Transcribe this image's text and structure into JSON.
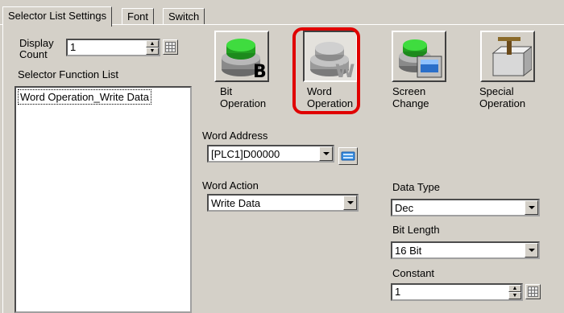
{
  "tabs": [
    {
      "label": "Selector List Settings",
      "active": true
    },
    {
      "label": "Font",
      "active": false
    },
    {
      "label": "Switch",
      "active": false
    }
  ],
  "left": {
    "display_count_label_1": "Display",
    "display_count_label_2": "Count",
    "display_count_value": "1",
    "function_list_label": "Selector Function List",
    "function_list_items": [
      "Word Operation_Write Data"
    ]
  },
  "function_buttons": [
    {
      "line1": "Bit",
      "line2": "Operation",
      "selected": false,
      "icon": "bit-switch-icon"
    },
    {
      "line1": "Word",
      "line2": "Operation",
      "selected": true,
      "icon": "word-switch-icon"
    },
    {
      "line1": "Screen",
      "line2": "Change",
      "selected": false,
      "icon": "screen-change-icon"
    },
    {
      "line1": "Special",
      "line2": "Operation",
      "selected": false,
      "icon": "special-operation-icon"
    }
  ],
  "word_address": {
    "label": "Word Address",
    "value": "[PLC1]D00000"
  },
  "word_action": {
    "label": "Word Action",
    "value": "Write Data"
  },
  "data_type": {
    "label": "Data Type",
    "value": "Dec"
  },
  "bit_length": {
    "label": "Bit Length",
    "value": "16 Bit"
  },
  "constant": {
    "label": "Constant",
    "value": "1"
  },
  "colors": {
    "highlight": "#e00000",
    "face": "#d4d0c8"
  }
}
